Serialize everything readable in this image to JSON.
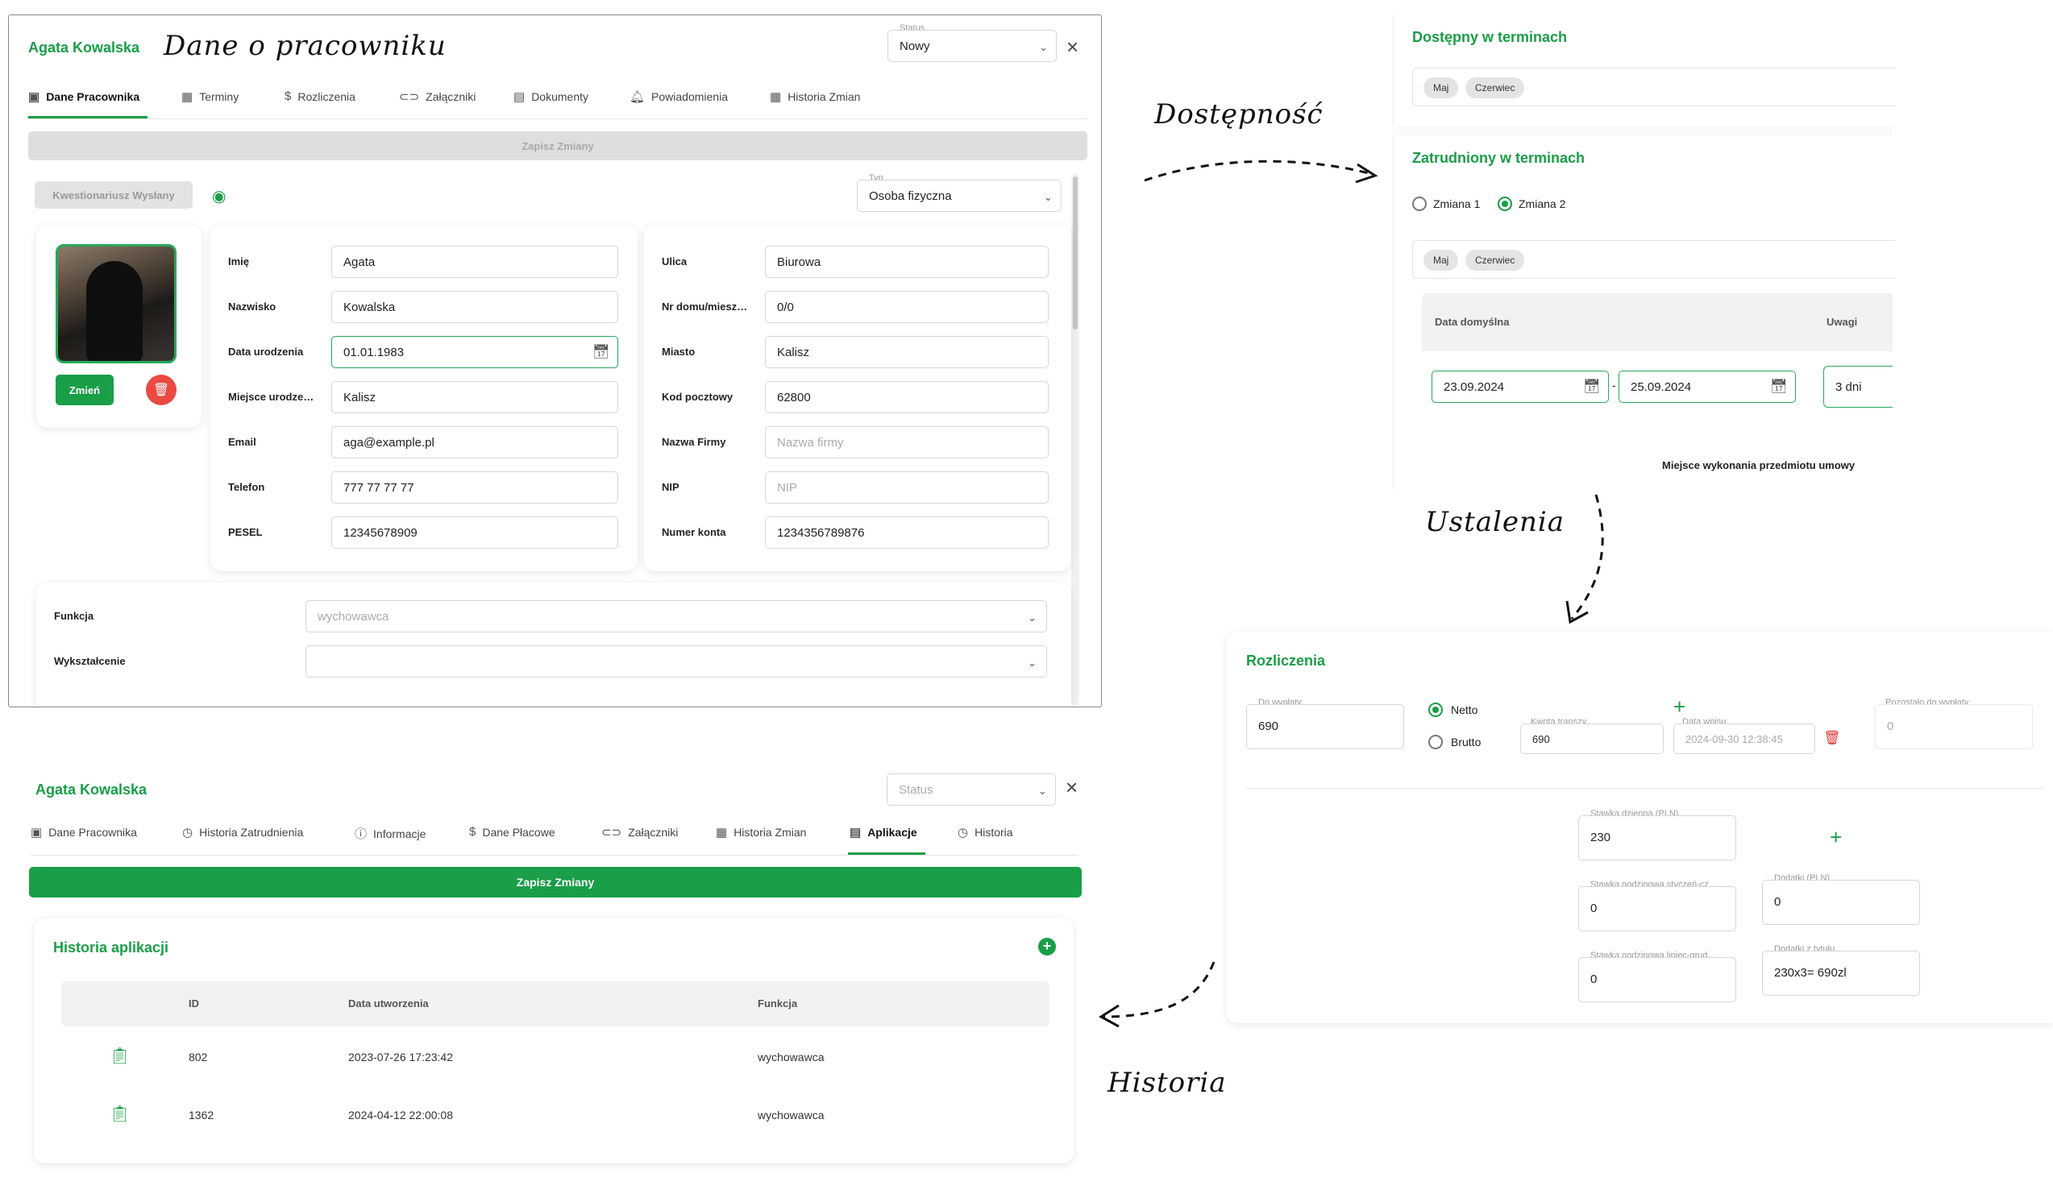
{
  "annotations": {
    "dane": "Dane o pracowniku",
    "dostepnosc": "Dostępność",
    "ustalenia": "Ustalenia",
    "historia": "Historia"
  },
  "employee": {
    "name": "Agata Kowalska",
    "status_label": "Status",
    "status_value": "Nowy",
    "tabs": [
      "Dane Pracownika",
      "Terminy",
      "Rozliczenia",
      "Załączniki",
      "Dokumenty",
      "Powiadomienia",
      "Historia Zmian"
    ],
    "save_label": "Zapisz Zmiany",
    "questionnaire_label": "Kwestionariusz Wysłany",
    "type_label": "Typ",
    "type_value": "Osoba fizyczna",
    "change_photo_label": "Zmień",
    "fields_left": [
      {
        "label": "Imię",
        "value": "Agata"
      },
      {
        "label": "Nazwisko",
        "value": "Kowalska"
      },
      {
        "label": "Data urodzenia",
        "value": "01.01.1983"
      },
      {
        "label": "Miejsce urodze…",
        "value": "Kalisz"
      },
      {
        "label": "Email",
        "value": "aga@example.pl"
      },
      {
        "label": "Telefon",
        "value": "777 77 77 77"
      },
      {
        "label": "PESEL",
        "value": "12345678909"
      }
    ],
    "fields_right": [
      {
        "label": "Ulica",
        "value": "Biurowa"
      },
      {
        "label": "Nr domu/miesz…",
        "value": "0/0"
      },
      {
        "label": "Miasto",
        "value": "Kalisz"
      },
      {
        "label": "Kod pocztowy",
        "value": "62800"
      },
      {
        "label": "Nazwa Firmy",
        "value": "Nazwa firmy"
      },
      {
        "label": "NIP",
        "value": "NIP"
      },
      {
        "label": "Numer konta",
        "value": "1234356789876"
      }
    ],
    "funkcja_label": "Funkcja",
    "funkcja_value": "wychowawca",
    "wyksztalcenie_label": "Wykształcenie",
    "wyksztalcenie_value": ""
  },
  "availability": {
    "available_title": "Dostępny w terminach",
    "available_chips": [
      "Maj",
      "Czerwiec"
    ],
    "employed_title": "Zatrudniony w terminach",
    "shift1": "Zmiana 1",
    "shift2": "Zmiana 2",
    "employed_chips": [
      "Maj",
      "Czerwiec"
    ],
    "col_date": "Data domyślna",
    "col_notes": "Uwagi",
    "date_from": "23.09.2024",
    "date_sep": "-",
    "date_to": "25.09.2024",
    "notes_value": "3 dni",
    "place_label": "Miejsce wykonania przedmiotu umowy"
  },
  "settlements": {
    "title": "Rozliczenia",
    "payout_label": "Do wypłaty",
    "payout_value": "690",
    "netto": "Netto",
    "brutto": "Brutto",
    "tranche_label": "Kwota transzy",
    "tranche_value": "690",
    "entry_date_label": "Data wpisu",
    "entry_date_value": "2024-09-30 12:38:45",
    "remaining_label": "Pozostało do wypłaty",
    "remaining_value": "0",
    "daily_rate_label": "Stawka dzienna (PLN)",
    "daily_rate_value": "230",
    "hourly_jan_label": "Stawka godzinowa styczeń-cz…",
    "hourly_jan_value": "0",
    "bonus_label": "Dodatki (PLN)",
    "bonus_value": "0",
    "hourly_jul_label": "Stawka godzinowa lipiec-grud…",
    "hourly_jul_value": "0",
    "bonus_title_label": "Dodatki z tytułu",
    "bonus_title_value": "230x3= 690zl"
  },
  "history": {
    "name": "Agata Kowalska",
    "status_placeholder": "Status",
    "tabs": [
      "Dane Pracownika",
      "Historia Zatrudnienia",
      "Informacje",
      "Dane Płacowe",
      "Załączniki",
      "Historia Zmian",
      "Aplikacje",
      "Historia"
    ],
    "save_label": "Zapisz Zmiany",
    "section_title": "Historia aplikacji",
    "columns": [
      "ID",
      "Data utworzenia",
      "Funkcja"
    ],
    "rows": [
      {
        "id": "802",
        "date": "2023-07-26 17:23:42",
        "func": "wychowawca"
      },
      {
        "id": "1362",
        "date": "2024-04-12 22:00:08",
        "func": "wychowawca"
      }
    ]
  }
}
